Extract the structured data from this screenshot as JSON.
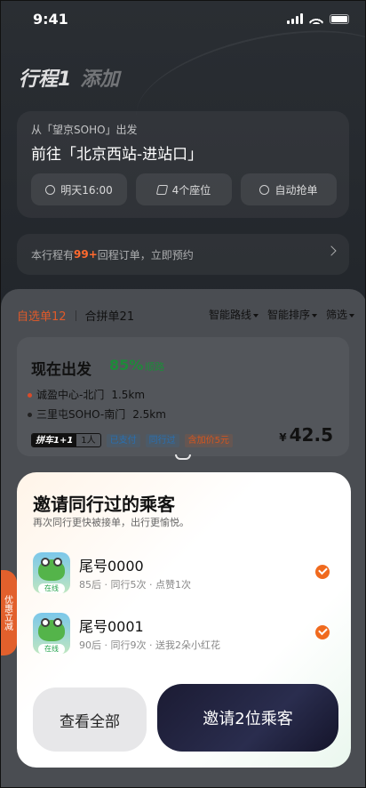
{
  "status_bar": {
    "time": "9:41"
  },
  "header": {
    "trip_title": "行程1",
    "add_label": "添加"
  },
  "route": {
    "from": "从「望京SOHO」出发",
    "to": "前往「北京西站-进站口」",
    "chips": [
      {
        "icon": "clock-icon",
        "label": "明天16:00"
      },
      {
        "icon": "seat-icon",
        "label": "4个座位"
      },
      {
        "icon": "auto-grab-icon",
        "label": "自动抢单"
      }
    ]
  },
  "return_bar": {
    "prefix": "本行程有",
    "count": "99+",
    "suffix": "回程订单，立即预约"
  },
  "list": {
    "tab_self": "自选单12",
    "tab_combined": "合拼单21",
    "filters": [
      "智能路线",
      "智能排序",
      "筛选"
    ]
  },
  "order": {
    "title": "现在出发",
    "match_pct": "85%",
    "match_label": "顺路",
    "stops": [
      {
        "name": "诚盈中心-北门",
        "distance": "1.5km",
        "color": "#d94b2a"
      },
      {
        "name": "三里屯SOHO-南门",
        "distance": "2.5km",
        "color": "#222222"
      }
    ],
    "pin_label": "拼车1+1",
    "pin_count": "1人",
    "tags": [
      "已支付",
      "同行过",
      "含加价5元"
    ],
    "currency": "¥",
    "price": "42.5"
  },
  "side_tab": {
    "label": "优惠立减"
  },
  "invite": {
    "title": "邀请同行过的乘客",
    "subtitle": "再次同行更快被接单，出行更愉悦。",
    "passengers": [
      {
        "name": "尾号0000",
        "meta": "85后 · 同行5次 · 点赞1次",
        "status": "在线",
        "checked": true
      },
      {
        "name": "尾号0001",
        "meta": "90后 · 同行9次 · 送我2朵小红花",
        "status": "在线",
        "checked": true
      }
    ],
    "view_all_label": "查看全部",
    "invite_label": "邀请2位乘客"
  },
  "colors": {
    "accent_orange": "#f06a1e",
    "match_green": "#1e8a3a",
    "cta_dark": "#1b1b33"
  }
}
